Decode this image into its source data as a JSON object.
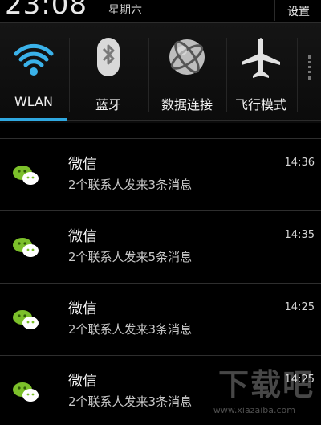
{
  "status": {
    "time": "23:08",
    "weekday": "星期六",
    "settings_label": "设置"
  },
  "toggles": [
    {
      "label": "WLAN",
      "icon": "wifi-icon",
      "active": true
    },
    {
      "label": "蓝牙",
      "icon": "bluetooth-icon",
      "active": false
    },
    {
      "label": "数据连接",
      "icon": "globe-icon",
      "active": false
    },
    {
      "label": "飞行模式",
      "icon": "airplane-icon",
      "active": false
    }
  ],
  "notifications": [
    {
      "app": "微信",
      "text": "2个联系人发来3条消息",
      "time": "14:36",
      "icon": "wechat-icon"
    },
    {
      "app": "微信",
      "text": "2个联系人发来5条消息",
      "time": "14:35",
      "icon": "wechat-icon"
    },
    {
      "app": "微信",
      "text": "2个联系人发来3条消息",
      "time": "14:25",
      "icon": "wechat-icon"
    },
    {
      "app": "微信",
      "text": "2个联系人发来3条消息",
      "time": "14:25",
      "icon": "wechat-icon"
    }
  ],
  "colors": {
    "accent": "#2fa8e0",
    "wechat_green": "#7cc02a"
  },
  "watermark": {
    "text": "下载吧",
    "url": "www.xiazaiba.com"
  }
}
